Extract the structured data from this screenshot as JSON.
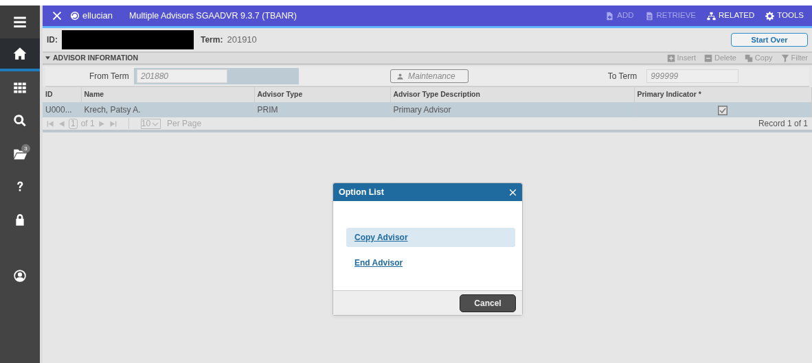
{
  "sidebar": {
    "items": [
      {
        "selected": false
      },
      {
        "selected": true
      },
      {
        "selected": false
      },
      {
        "selected": false
      },
      {
        "selected": false,
        "badge": "3"
      },
      {
        "selected": false
      },
      {
        "selected": false
      },
      {
        "selected": false
      }
    ]
  },
  "header": {
    "logo": "ellucian",
    "title": "Multiple Advisors SGAADVR 9.3.7 (TBANR)",
    "actions": [
      {
        "label": "ADD",
        "disabled": true
      },
      {
        "label": "RETRIEVE",
        "disabled": true
      },
      {
        "label": "RELATED",
        "disabled": false
      },
      {
        "label": "TOOLS",
        "disabled": false
      }
    ]
  },
  "key_block": {
    "id_label": "ID:",
    "term_label": "Term:",
    "term_value": "201910",
    "start_over": "Start Over"
  },
  "section": {
    "title": "ADVISOR INFORMATION",
    "expanded": true,
    "tools": [
      {
        "label": "Insert",
        "disabled": true
      },
      {
        "label": "Delete",
        "disabled": true
      },
      {
        "label": "Copy",
        "disabled": true
      },
      {
        "label": "Filter",
        "disabled": true
      }
    ],
    "from_term_label": "From Term",
    "from_term": "201880",
    "maintenance": "Maintenance",
    "to_term_label": "To Term",
    "to_term": "999999",
    "table": {
      "columns": [
        "ID",
        "Name",
        "Advisor Type",
        "Advisor Type Description",
        "Primary Indicator *"
      ],
      "rows": [
        {
          "cells": [
            "U000...",
            "Krech, Patsy A.",
            "PRIM",
            "Primary Advisor"
          ],
          "primary": true,
          "selected": true
        }
      ]
    },
    "pager": {
      "page": "1",
      "of": "of 1",
      "per_page_value": "10",
      "per_page": "Per Page",
      "record": "Record 1 of 1"
    }
  },
  "dialog": {
    "title": "Option List",
    "options": [
      {
        "label": "Copy Advisor",
        "selected": true
      },
      {
        "label": "End Advisor",
        "selected": false
      }
    ],
    "cancel": "Cancel"
  }
}
